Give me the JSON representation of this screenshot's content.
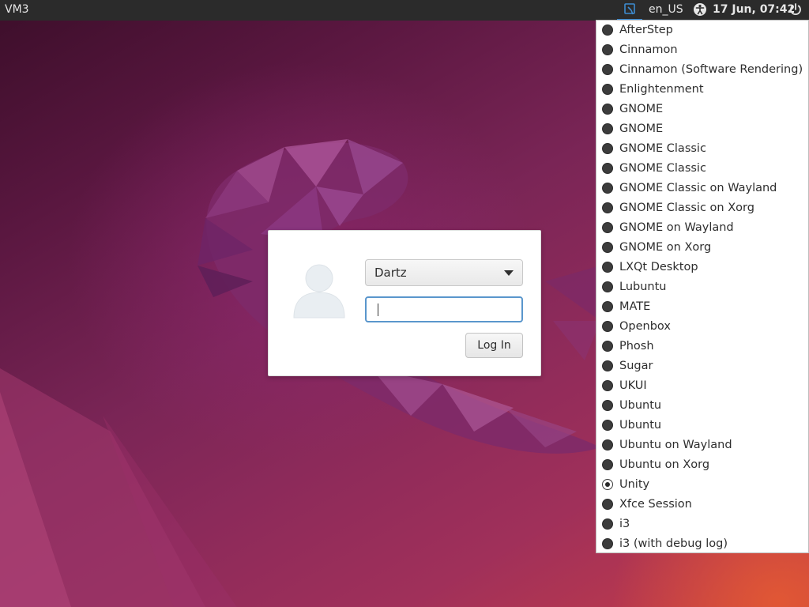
{
  "topbar": {
    "hostname": "VM3",
    "language": "en_US",
    "datetime": "17 Jun, 07:42",
    "session_icon": "session-icon",
    "accessibility_icon": "accessibility-icon",
    "power_icon": "power-icon"
  },
  "login": {
    "username": "Dartz",
    "password_value": "",
    "login_label": "Log In",
    "avatar_icon": "user-avatar-icon"
  },
  "session_menu": {
    "items": [
      {
        "label": "AfterStep",
        "selected": false
      },
      {
        "label": "Cinnamon",
        "selected": false
      },
      {
        "label": "Cinnamon (Software Rendering)",
        "selected": false
      },
      {
        "label": "Enlightenment",
        "selected": false
      },
      {
        "label": "GNOME",
        "selected": false
      },
      {
        "label": "GNOME",
        "selected": false
      },
      {
        "label": "GNOME Classic",
        "selected": false
      },
      {
        "label": "GNOME Classic",
        "selected": false
      },
      {
        "label": "GNOME Classic on Wayland",
        "selected": false
      },
      {
        "label": "GNOME Classic on Xorg",
        "selected": false
      },
      {
        "label": "GNOME on Wayland",
        "selected": false
      },
      {
        "label": "GNOME on Xorg",
        "selected": false
      },
      {
        "label": "LXQt Desktop",
        "selected": false
      },
      {
        "label": "Lubuntu",
        "selected": false
      },
      {
        "label": "MATE",
        "selected": false
      },
      {
        "label": "Openbox",
        "selected": false
      },
      {
        "label": "Phosh",
        "selected": false
      },
      {
        "label": "Sugar",
        "selected": false
      },
      {
        "label": "UKUI",
        "selected": false
      },
      {
        "label": "Ubuntu",
        "selected": false
      },
      {
        "label": "Ubuntu",
        "selected": false
      },
      {
        "label": "Ubuntu on Wayland",
        "selected": false
      },
      {
        "label": "Ubuntu on Xorg",
        "selected": false
      },
      {
        "label": "Unity",
        "selected": true
      },
      {
        "label": "Xfce Session",
        "selected": false
      },
      {
        "label": "i3",
        "selected": false
      },
      {
        "label": "i3 (with debug log)",
        "selected": false
      }
    ]
  },
  "colors": {
    "topbar_bg": "#2b2b2b",
    "indicator_accent": "#3d8bd0",
    "focus_border": "#5a96cc",
    "wallpaper_dark": "#3c0e2a",
    "wallpaper_mid": "#8c2a5a",
    "wallpaper_orange": "#e25834"
  }
}
